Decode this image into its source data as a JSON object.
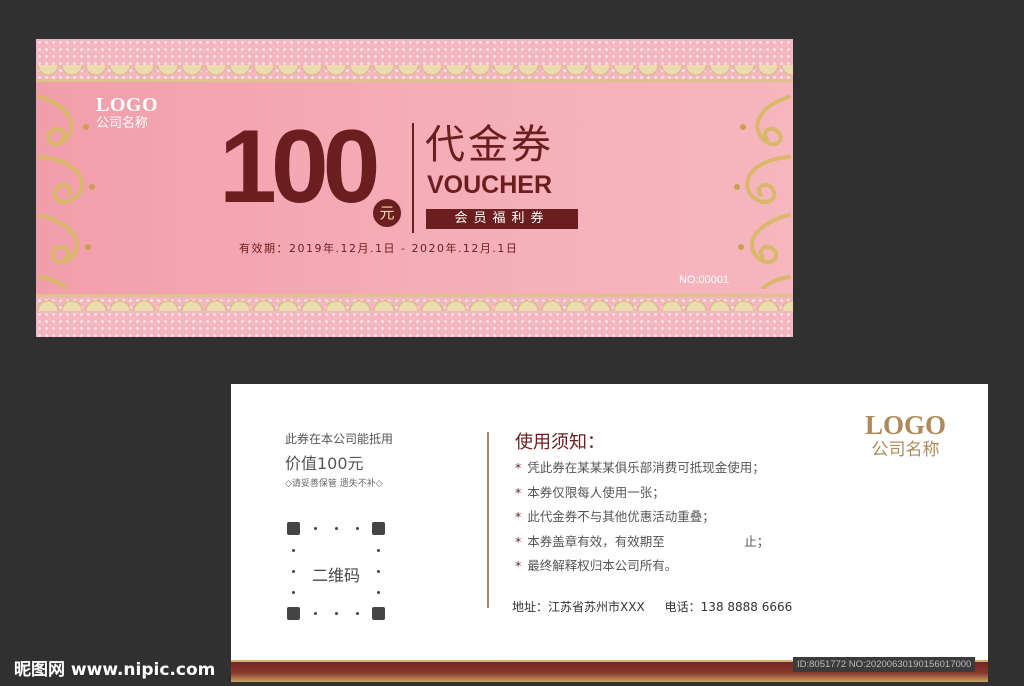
{
  "front": {
    "logo_word": "LOGO",
    "company": "公司名称",
    "amount": "100",
    "yuan": "元",
    "title_cn": "代金券",
    "title_en": "VOUCHER",
    "member_tag": "会员福利券",
    "validity": "有效期：2019年.12月.1日 - 2020年.12月.1日",
    "serial": "NO:00001"
  },
  "back": {
    "use_note": "此券在本公司能抵用",
    "use_value": "价值100元",
    "keep_note": "◇请妥善保管 遗失不补◇",
    "qr_label": "二维码",
    "rules_title": "使用须知：",
    "rules": [
      "凭此券在某某某俱乐部消费可抵现金使用；",
      "本券仅限每人使用一张；",
      "此代金券不与其他优惠活动重叠；",
      "本券盖章有效，有效期至                    止；",
      "最终解释权归本公司所有。"
    ],
    "address": "地址：江苏省苏州市XXX",
    "phone": "电话：138 8888 6666",
    "logo_word": "LOGO",
    "company": "公司名称"
  },
  "watermark": {
    "site": "昵图网 www.nipic.com",
    "id": "ID:8051772 NO:20200630190156017000"
  },
  "colors": {
    "background": "#303030",
    "pink": "#f2a9b3",
    "maroon": "#6b1e1e",
    "gold": "#dcc38a"
  }
}
